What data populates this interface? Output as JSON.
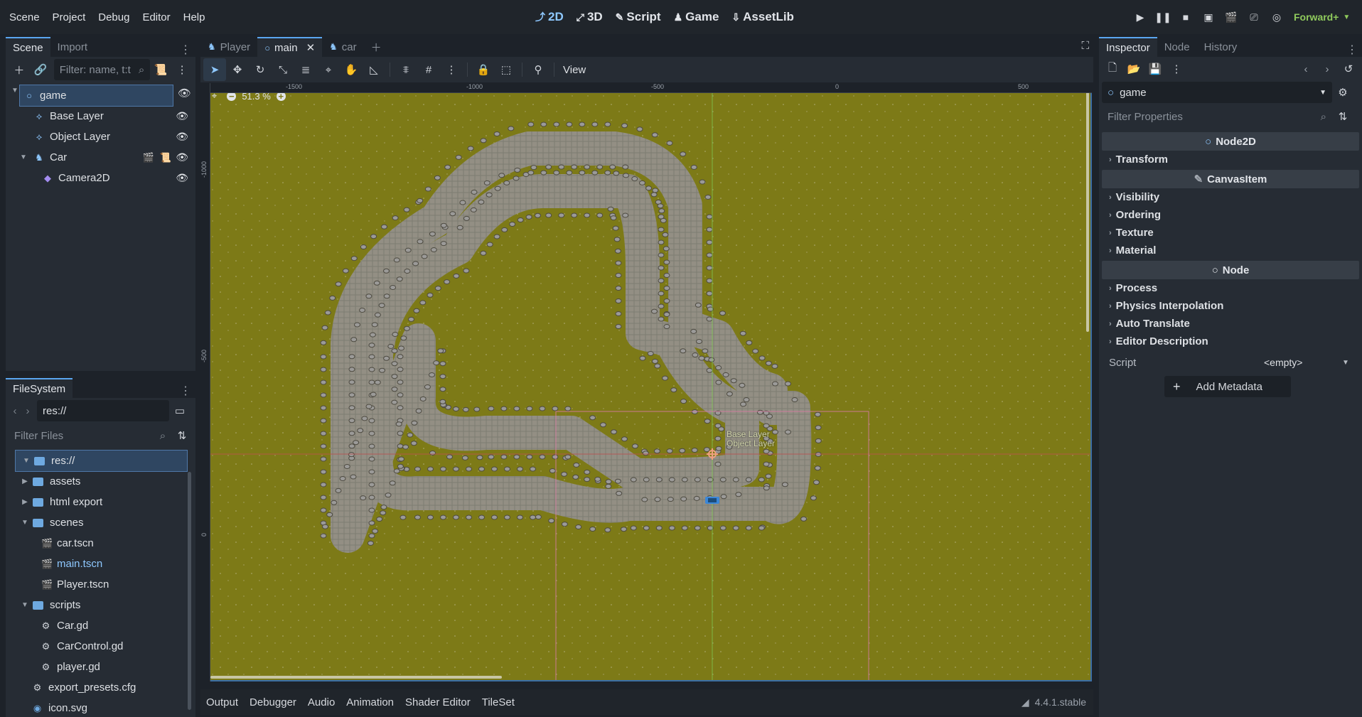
{
  "menu": [
    "Scene",
    "Project",
    "Debug",
    "Editor",
    "Help"
  ],
  "modes": [
    {
      "label": "2D",
      "icon": "2d-mode-icon",
      "active": true
    },
    {
      "label": "3D",
      "icon": "3d-mode-icon"
    },
    {
      "label": "Script",
      "icon": "script-icon"
    },
    {
      "label": "Game",
      "icon": "game-icon"
    },
    {
      "label": "AssetLib",
      "icon": "assetlib-icon"
    }
  ],
  "renderer": "Forward+",
  "scene_dock": {
    "tabs": [
      "Scene",
      "Import"
    ],
    "filter_placeholder": "Filter: name, t:t",
    "nodes": [
      {
        "name": "game",
        "icon": "node2d-icon",
        "depth": 0,
        "selected": true,
        "expanded": true
      },
      {
        "name": "Base Layer",
        "icon": "tilemap-layer-icon",
        "depth": 1
      },
      {
        "name": "Object Layer",
        "icon": "tilemap-layer-icon",
        "depth": 1
      },
      {
        "name": "Car",
        "icon": "characterbody-icon",
        "depth": 1,
        "expanded": true
      },
      {
        "name": "Camera2D",
        "icon": "camera2d-icon",
        "depth": 2
      }
    ]
  },
  "filesystem": {
    "tab": "FileSystem",
    "path": "res://",
    "filter_placeholder": "Filter Files",
    "items": [
      {
        "name": "res://",
        "type": "folder",
        "depth": 0,
        "selected": true,
        "expanded": true
      },
      {
        "name": "assets",
        "type": "folder",
        "depth": 1
      },
      {
        "name": "html export",
        "type": "folder",
        "depth": 1
      },
      {
        "name": "scenes",
        "type": "folder",
        "depth": 1,
        "expanded": true
      },
      {
        "name": "car.tscn",
        "type": "scene",
        "depth": 2
      },
      {
        "name": "main.tscn",
        "type": "scene",
        "depth": 2,
        "highlight": true
      },
      {
        "name": "Player.tscn",
        "type": "scene",
        "depth": 2
      },
      {
        "name": "scripts",
        "type": "folder",
        "depth": 1,
        "expanded": true
      },
      {
        "name": "Car.gd",
        "type": "gear",
        "depth": 2
      },
      {
        "name": "CarControl.gd",
        "type": "gear",
        "depth": 2
      },
      {
        "name": "player.gd",
        "type": "gear",
        "depth": 2
      },
      {
        "name": "export_presets.cfg",
        "type": "gear",
        "depth": 1
      },
      {
        "name": "icon.svg",
        "type": "image",
        "depth": 1
      }
    ]
  },
  "editor_tabs": [
    {
      "label": "Player",
      "icon": "characterbody-icon"
    },
    {
      "label": "main",
      "icon": "node2d-icon",
      "selected": true
    },
    {
      "label": "car",
      "icon": "characterbody-icon"
    }
  ],
  "view_menu": "View",
  "zoom": "51.3 %",
  "ruler_ticks_x": [
    "-1500",
    "-1000",
    "-500",
    "0",
    "500"
  ],
  "ruler_ticks_y": [
    "-1000",
    "-500",
    "0"
  ],
  "canvas_labels": [
    "Base Layer",
    "Object Layer"
  ],
  "bottom_tabs": [
    "Output",
    "Debugger",
    "Audio",
    "Animation",
    "Shader Editor",
    "TileSet"
  ],
  "version": "4.4.1.stable",
  "inspector": {
    "tabs": [
      "Inspector",
      "Node",
      "History"
    ],
    "node_name": "game",
    "filter_placeholder": "Filter Properties",
    "sections": [
      {
        "title": "Node2D",
        "icon": "node2d-icon",
        "props": [
          "Transform"
        ]
      },
      {
        "title": "CanvasItem",
        "icon": "canvasitem-icon",
        "props": [
          "Visibility",
          "Ordering",
          "Texture",
          "Material"
        ]
      },
      {
        "title": "Node",
        "icon": "node-icon",
        "props": [
          "Process",
          "Physics Interpolation",
          "Auto Translate",
          "Editor Description"
        ]
      }
    ],
    "script_label": "Script",
    "script_value": "<empty>",
    "add_metadata": "Add Metadata"
  },
  "colors": {
    "accent": "#5aa6f0",
    "grass": "#7d7a17",
    "road": "#8c8a80",
    "selection": "#2f4661"
  }
}
